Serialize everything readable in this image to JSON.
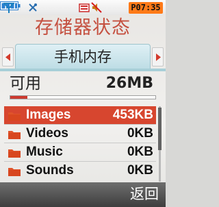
{
  "status_bar": {
    "time": "P07:35",
    "icons": [
      "signal-antenna-icon",
      "no-network-icon",
      "message-envelope-icon",
      "mute-speaker-icon",
      "battery-icon"
    ]
  },
  "screen": {
    "title": "存储器状态",
    "tab_label": "手机内存"
  },
  "available": {
    "label": "可用",
    "value": "26MB"
  },
  "usage_fraction": 0.12,
  "categories": [
    {
      "name": "Images",
      "size": "453KB",
      "selected": true
    },
    {
      "name": "Videos",
      "size": "0KB",
      "selected": false
    },
    {
      "name": "Music",
      "size": "0KB",
      "selected": false
    },
    {
      "name": "Sounds",
      "size": "0KB",
      "selected": false
    }
  ],
  "softkeys": {
    "right": "返回"
  },
  "colors": {
    "title": "#c55141",
    "selection": "#d7462f",
    "clock_bg": "#ff7a18",
    "tab_bg": "#bcdce4"
  }
}
